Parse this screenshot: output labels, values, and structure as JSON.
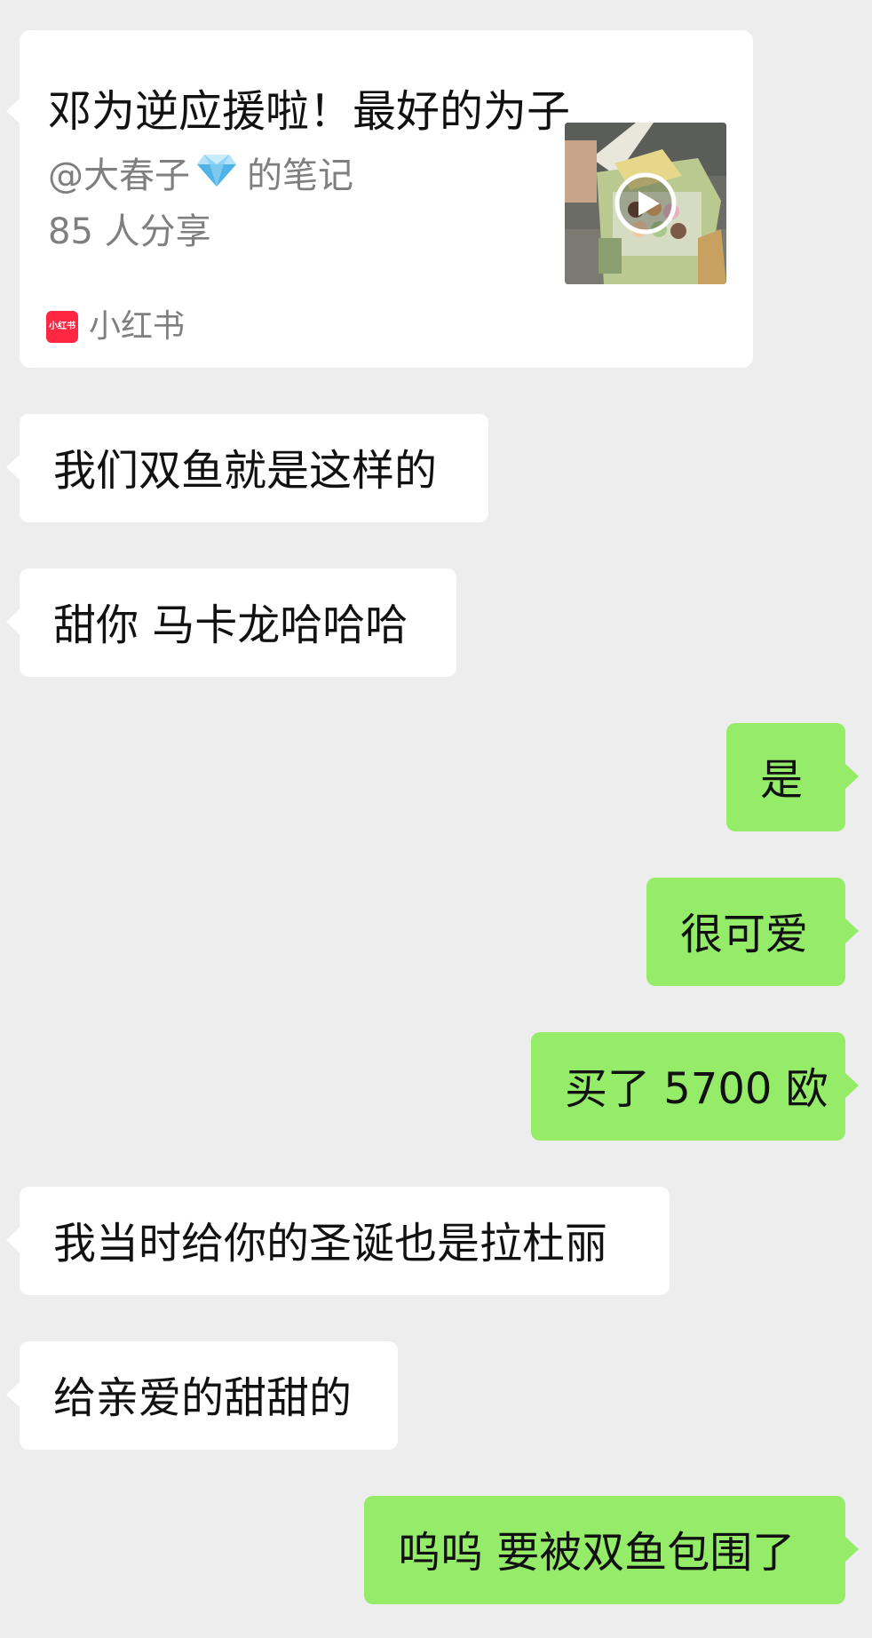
{
  "shared_card": {
    "title": "邓为逆应援啦！最好的为子",
    "author": "@大春子",
    "author_suffix": "的笔记",
    "share_count": "85 人分享",
    "source": "小红书",
    "source_logo_text": "小红书",
    "author_badge_icon": "diamond-icon",
    "thumbnail_overlay_icon": "play-icon"
  },
  "messages": [
    {
      "side": "left",
      "text": "我们双鱼就是这样的"
    },
    {
      "side": "left",
      "text": "甜你 马卡龙哈哈哈"
    },
    {
      "side": "right",
      "text": "是"
    },
    {
      "side": "right",
      "text": "很可爱"
    },
    {
      "side": "right",
      "text": "买了 5700 欧"
    },
    {
      "side": "left",
      "text": "我当时给你的圣诞也是拉杜丽"
    },
    {
      "side": "left",
      "text": "给亲爱的甜甜的"
    },
    {
      "side": "right",
      "text": "呜呜 要被双鱼包围了"
    }
  ],
  "colors": {
    "background": "#ededed",
    "incoming_bubble": "#ffffff",
    "outgoing_bubble": "#95ec69",
    "xiaohongshu_red": "#ff2741",
    "secondary_text": "#7f7f7f"
  }
}
